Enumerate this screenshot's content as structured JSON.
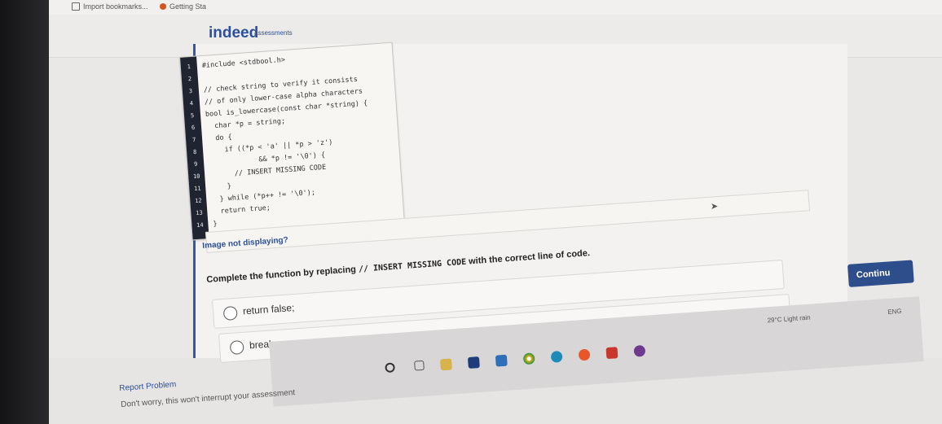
{
  "browser": {
    "bookmarks": [
      {
        "label": "Import bookmarks..."
      },
      {
        "label": "Getting Sta"
      }
    ]
  },
  "header": {
    "logo": "indeed",
    "logo_sub": "assessments"
  },
  "code": {
    "lines": [
      {
        "n": "1",
        "text": "#include <stdbool.h>"
      },
      {
        "n": "2",
        "text": ""
      },
      {
        "n": "3",
        "text": "// check string to verify it consists"
      },
      {
        "n": "4",
        "text": "// of only lower-case alpha characters"
      },
      {
        "n": "5",
        "text": "bool is_lowercase(const char *string) {"
      },
      {
        "n": "6",
        "text": "  char *p = string;"
      },
      {
        "n": "7",
        "text": "  do {"
      },
      {
        "n": "8",
        "text": "    if ((*p < 'a' || *p > 'z')"
      },
      {
        "n": "9",
        "text": "            && *p != '\\0') {"
      },
      {
        "n": "10",
        "text": "      // INSERT MISSING CODE"
      },
      {
        "n": "11",
        "text": "    }"
      },
      {
        "n": "12",
        "text": "  } while (*p++ != '\\0');"
      },
      {
        "n": "13",
        "text": "  return true;"
      },
      {
        "n": "14",
        "text": "}"
      }
    ]
  },
  "image_link": "Image not displaying?",
  "question": {
    "prefix": "Complete the function by replacing ",
    "code": "// INSERT MISSING CODE",
    "suffix": " with the correct line of code."
  },
  "options": [
    {
      "label": "return false;"
    },
    {
      "label": "break;"
    }
  ],
  "continue_label": "Continu",
  "footer": {
    "report": "Report Problem",
    "note": "Don't worry, this won't interrupt your assessment"
  },
  "tray": {
    "weather": "29°C  Light rain",
    "lang": "ENG"
  }
}
